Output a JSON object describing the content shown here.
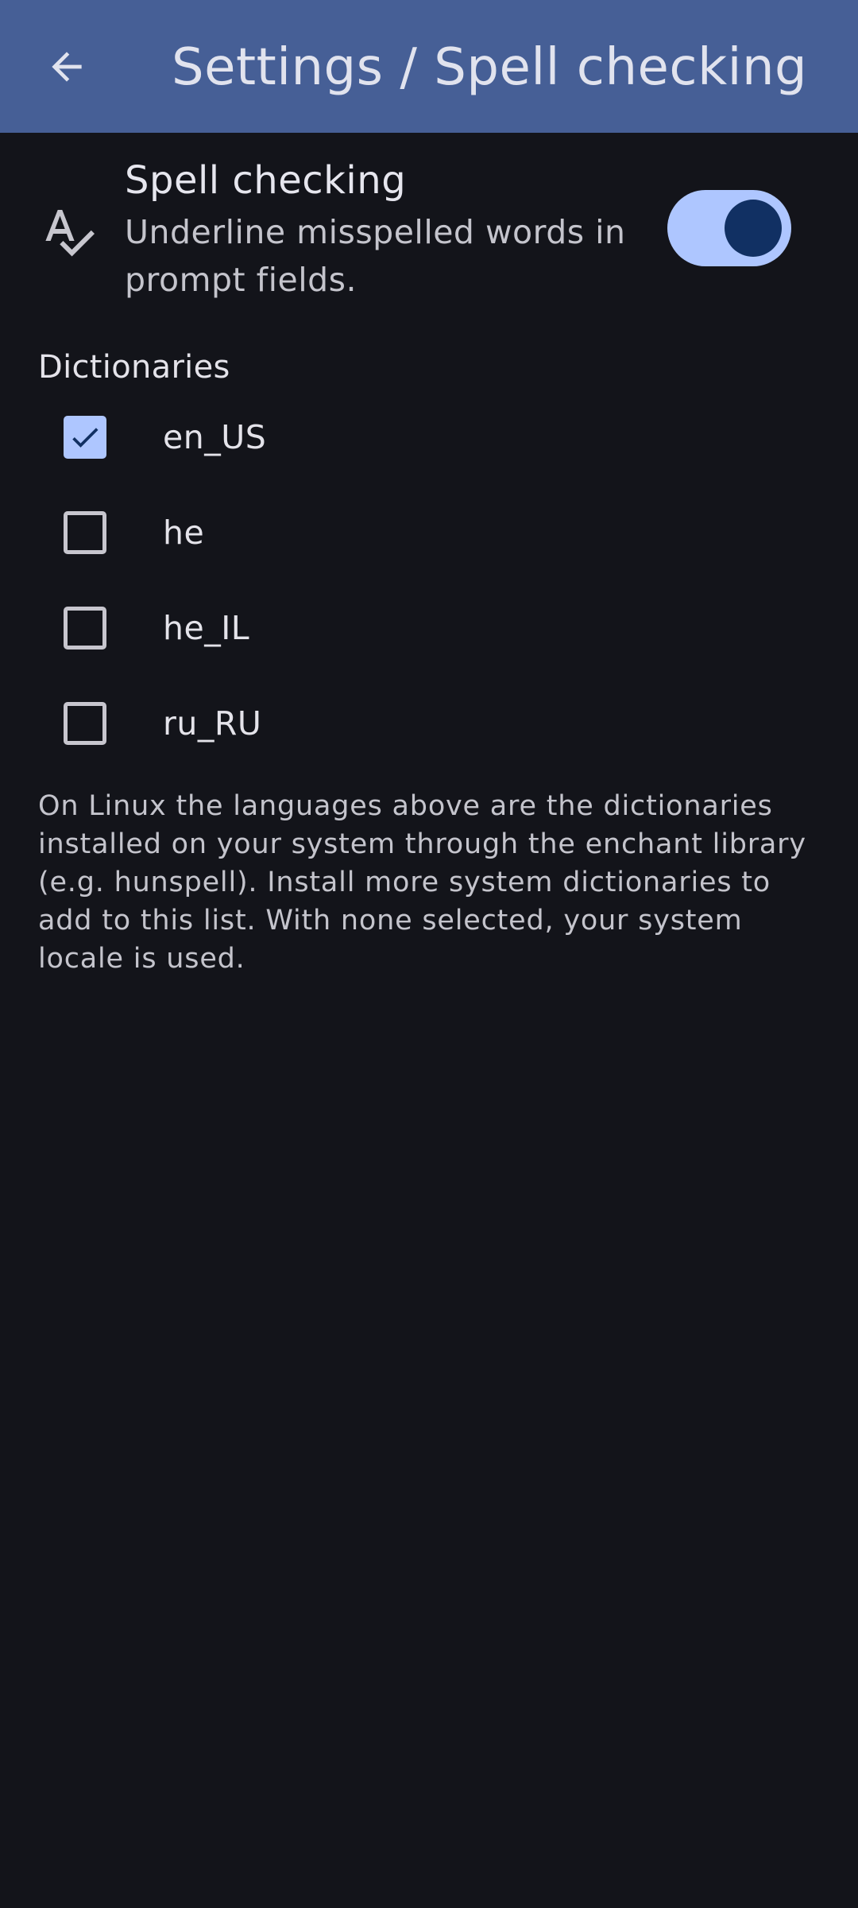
{
  "header": {
    "title": "Settings / Spell checking",
    "back_icon": "arrow-back-icon"
  },
  "spell_setting": {
    "icon": "spellcheck-icon",
    "title": "Spell checking",
    "description": "Underline misspelled words in prompt fields.",
    "enabled": true
  },
  "dictionaries": {
    "header": "Dictionaries",
    "items": [
      {
        "label": "en_US",
        "checked": true
      },
      {
        "label": "he",
        "checked": false
      },
      {
        "label": "he_IL",
        "checked": false
      },
      {
        "label": "ru_RU",
        "checked": false
      }
    ]
  },
  "footnote": "On Linux the languages above are the dictionaries installed on your system through the enchant library (e.g. hunspell). Install more system dictionaries to add to this list. With none selected, your system locale is used.",
  "colors": {
    "app_bar": "#465f96",
    "background": "#13141a",
    "accent": "#aec6ff",
    "accent_dark": "#113063"
  }
}
